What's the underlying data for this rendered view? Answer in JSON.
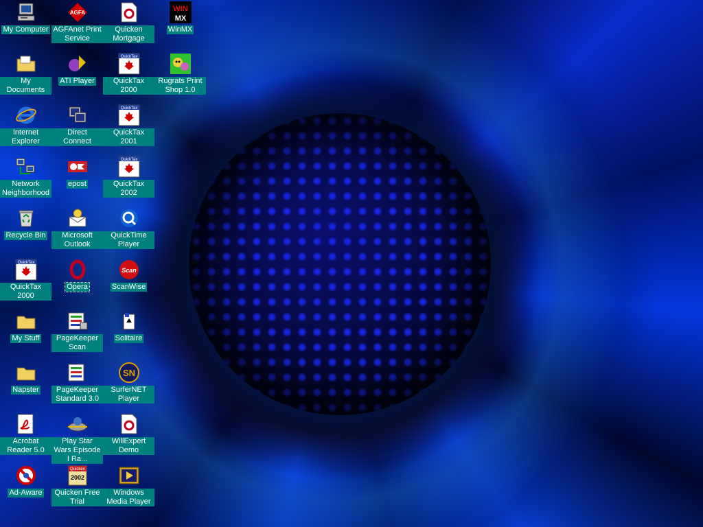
{
  "desktop": {
    "icons": [
      {
        "label": "My Computer",
        "icon": "my-computer-icon"
      },
      {
        "label": "AGFAnet Print Service",
        "icon": "agfa-icon"
      },
      {
        "label": "Quicken Mortgage",
        "icon": "quicken-document-icon"
      },
      {
        "label": "WinMX",
        "icon": "winmx-icon"
      },
      {
        "label": "My Documents",
        "icon": "folder-icon"
      },
      {
        "label": "ATI Player",
        "icon": "ati-player-icon"
      },
      {
        "label": "QuickTax 2000",
        "icon": "quicktax-icon"
      },
      {
        "label": "Rugrats Print Shop 1.0",
        "icon": "rugrats-icon"
      },
      {
        "label": "Internet Explorer",
        "icon": "internet-explorer-icon"
      },
      {
        "label": "Direct Connect",
        "icon": "direct-connect-icon"
      },
      {
        "label": "QuickTax 2001",
        "icon": "quicktax-icon"
      },
      {
        "label": "Network Neighborhood",
        "icon": "network-icon"
      },
      {
        "label": "epost",
        "icon": "epost-icon"
      },
      {
        "label": "QuickTax 2002",
        "icon": "quicktax-icon"
      },
      {
        "label": "Recycle Bin",
        "icon": "recycle-bin-icon"
      },
      {
        "label": "Microsoft Outlook",
        "icon": "outlook-icon"
      },
      {
        "label": "QuickTime Player",
        "icon": "quicktime-icon"
      },
      {
        "label": "QuickTax 2000",
        "icon": "quicktax-icon"
      },
      {
        "label": "Opera",
        "icon": "opera-icon"
      },
      {
        "label": "ScanWise",
        "icon": "scanwise-icon"
      },
      {
        "label": "My Stuff",
        "icon": "folder-icon"
      },
      {
        "label": "PageKeeper Scan",
        "icon": "pagekeeper-icon"
      },
      {
        "label": "Solitaire",
        "icon": "solitaire-icon"
      },
      {
        "label": "Napster",
        "icon": "folder-icon"
      },
      {
        "label": "PageKeeper Standard 3.0",
        "icon": "pagekeeper-icon"
      },
      {
        "label": "SurferNET Player",
        "icon": "surfernet-icon"
      },
      {
        "label": "Acrobat Reader 5.0",
        "icon": "acrobat-icon"
      },
      {
        "label": "Play Star Wars Episode I Ra...",
        "icon": "star-wars-icon"
      },
      {
        "label": "WillExpert Demo",
        "icon": "quicken-document-icon"
      },
      {
        "label": "Ad-Aware",
        "icon": "ad-aware-icon"
      },
      {
        "label": "Quicken Free Trial",
        "icon": "quicken-box-icon"
      },
      {
        "label": "Windows Media Player",
        "icon": "media-player-icon"
      }
    ],
    "text_glyphs": {
      "agfa": "AGFA",
      "winmx_top": "WIN",
      "winmx_bottom": "MX",
      "quicktax": "QuickTax",
      "scan": "Scan",
      "sn": "SN",
      "quicken": "Quicken",
      "year2002": "2002",
      "opera": "O"
    },
    "colors": {
      "label_bg": "#00807e",
      "label_text": "#ffffff",
      "flower_blue": "#1a2cff"
    }
  }
}
